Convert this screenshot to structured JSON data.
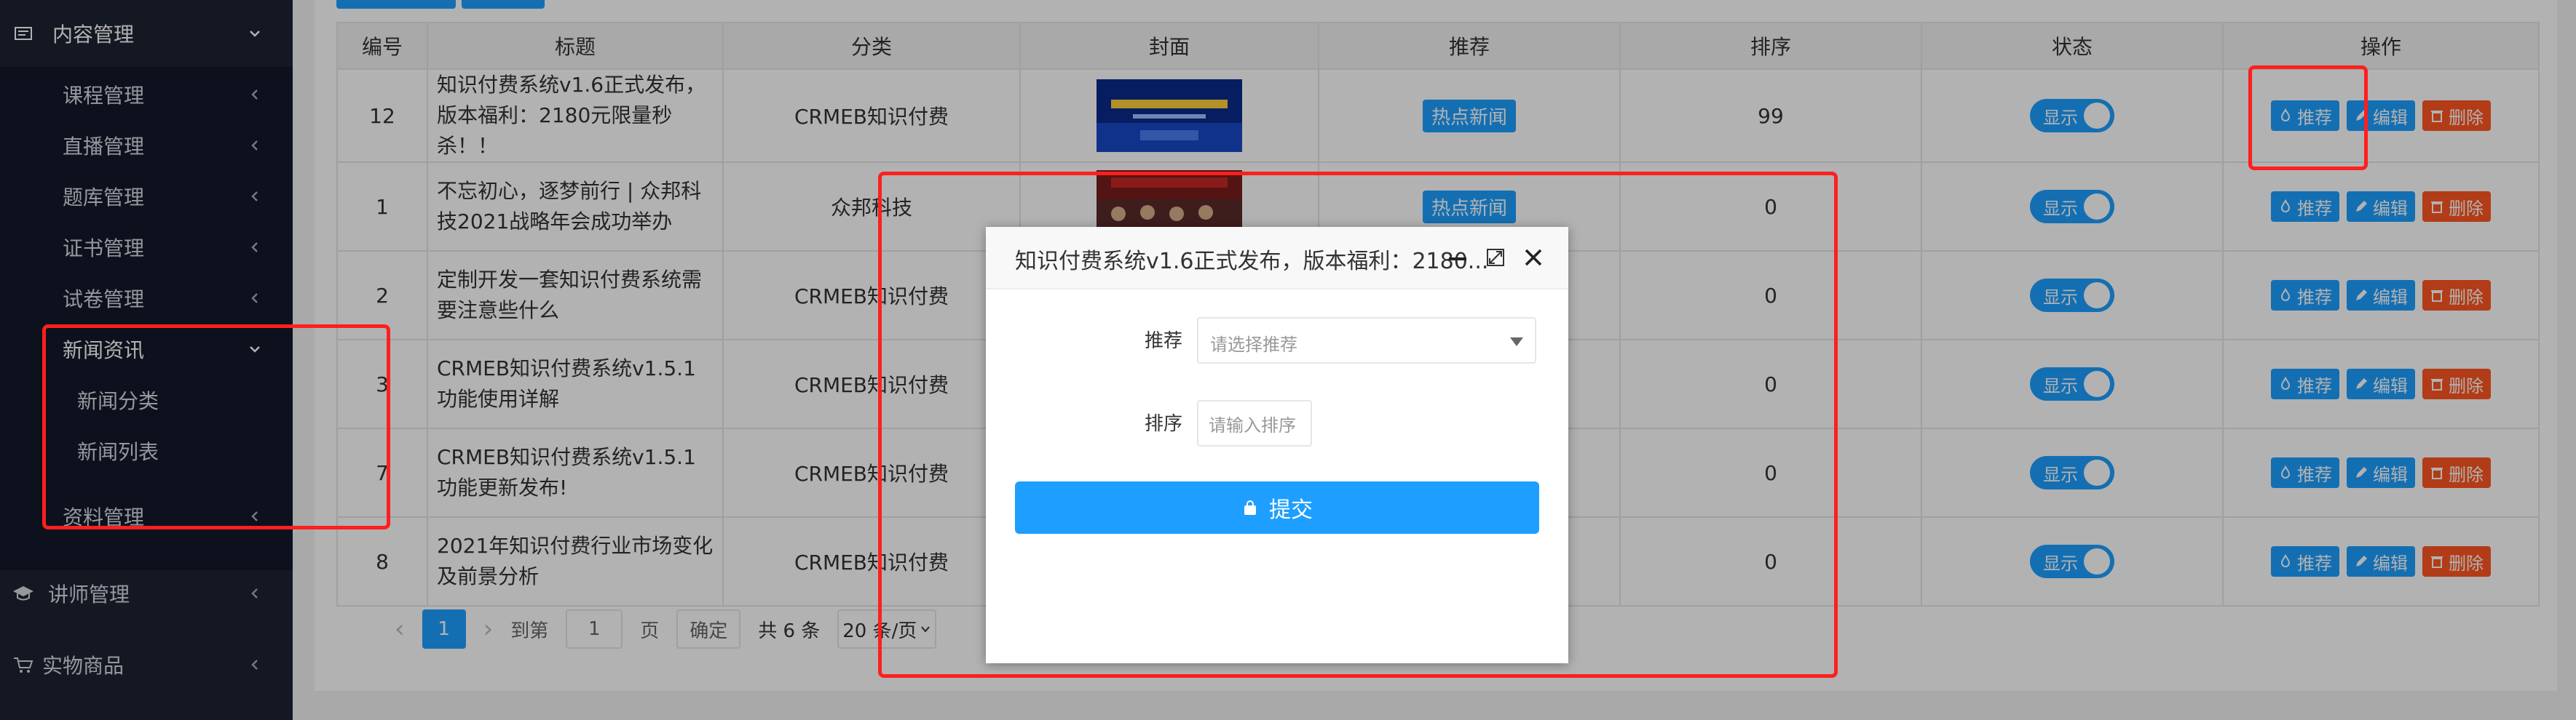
{
  "sidebar": {
    "top": {
      "label": "内容管理"
    },
    "items": [
      {
        "label": "课程管理"
      },
      {
        "label": "直播管理"
      },
      {
        "label": "题库管理"
      },
      {
        "label": "证书管理"
      },
      {
        "label": "试卷管理"
      },
      {
        "label": "新闻资讯"
      },
      {
        "label": "新闻分类"
      },
      {
        "label": "新闻列表"
      },
      {
        "label": "资料管理"
      }
    ],
    "bottom": [
      {
        "label": "讲师管理"
      },
      {
        "label": "实物商品"
      }
    ]
  },
  "table": {
    "headers": [
      "编号",
      "标题",
      "分类",
      "封面",
      "推荐",
      "排序",
      "状态",
      "操作"
    ],
    "rows": [
      {
        "id": "12",
        "title": "知识付费系统v1.6正式发布，版本福利：2180元限量秒杀！！",
        "category": "CRMEB知识付费",
        "recommend": "热点新闻",
        "sort": "99",
        "status": "显示"
      },
      {
        "id": "1",
        "title": "不忘初心，逐梦前行 | 众邦科技2021战略年会成功举办",
        "category": "众邦科技",
        "recommend": "热点新闻",
        "sort": "0",
        "status": "显示"
      },
      {
        "id": "2",
        "title": "定制开发一套知识付费系统需要注意些什么",
        "category": "CRMEB知识付费",
        "recommend": "",
        "sort": "0",
        "status": "显示"
      },
      {
        "id": "3",
        "title": "CRMEB知识付费系统v1.5.1功能使用详解",
        "category": "CRMEB知识付费",
        "recommend": "",
        "sort": "0",
        "status": "显示"
      },
      {
        "id": "7",
        "title": "CRMEB知识付费系统v1.5.1功能更新发布!",
        "category": "CRMEB知识付费",
        "recommend": "",
        "sort": "0",
        "status": "显示"
      },
      {
        "id": "8",
        "title": "2021年知识付费行业市场变化及前景分析",
        "category": "CRMEB知识付费",
        "recommend": "",
        "sort": "0",
        "status": "显示"
      }
    ],
    "ops": {
      "recommend": "推荐",
      "edit": "编辑",
      "delete": "删除"
    }
  },
  "pager": {
    "prev": "‹",
    "current": "1",
    "next": "›",
    "goto_label": "到第",
    "goto_value": "1",
    "page_unit": "页",
    "confirm": "确定",
    "total": "共 6 条",
    "page_size": "20 条/页"
  },
  "modal": {
    "title": "知识付费系统v1.6正式发布，版本福利：2180...",
    "recommend_label": "推荐",
    "recommend_placeholder": "请选择推荐",
    "sort_label": "排序",
    "sort_placeholder": "请输入排序",
    "submit": "提交"
  },
  "colors": {
    "primary": "#1e9fff",
    "danger": "#ff5722",
    "sidebar": "#1d2333",
    "annotation": "#ff1f1f"
  }
}
